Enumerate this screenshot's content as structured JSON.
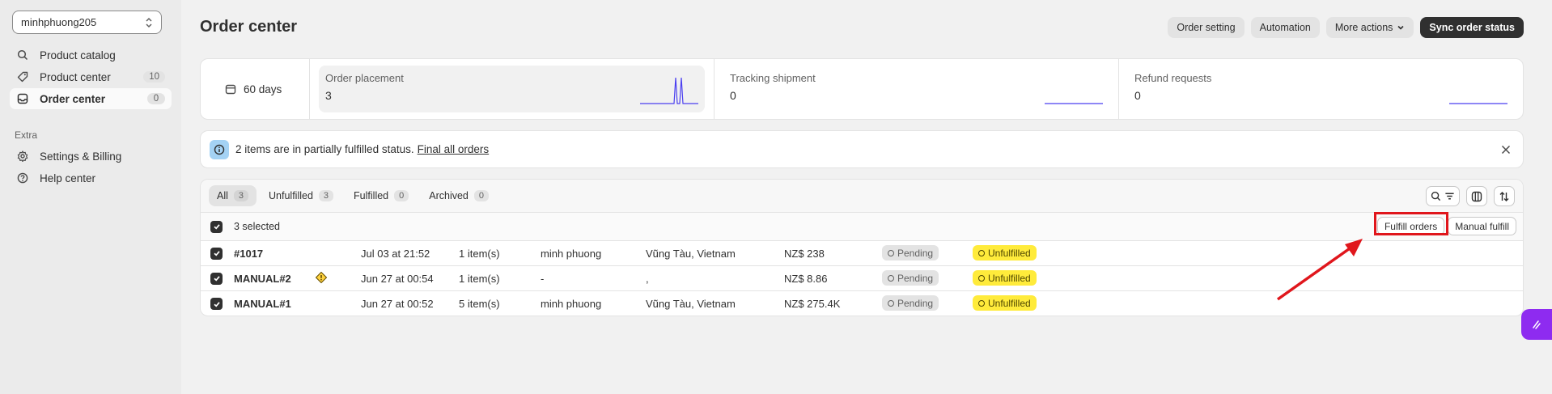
{
  "sidebar": {
    "store": "minhphuong205",
    "items": [
      {
        "label": "Product catalog",
        "count": ""
      },
      {
        "label": "Product center",
        "count": "10"
      },
      {
        "label": "Order center",
        "count": "0"
      }
    ],
    "extra_label": "Extra",
    "extra_items": [
      {
        "label": "Settings & Billing"
      },
      {
        "label": "Help center"
      }
    ]
  },
  "header": {
    "title": "Order center",
    "actions": {
      "order_setting": "Order setting",
      "automation": "Automation",
      "more_actions": "More actions",
      "sync": "Sync order status"
    }
  },
  "stats": {
    "range": "60 days",
    "cards": [
      {
        "label": "Order placement",
        "value": "3"
      },
      {
        "label": "Tracking shipment",
        "value": "0"
      },
      {
        "label": "Refund requests",
        "value": "0"
      }
    ]
  },
  "banner": {
    "text": "2 items are in partially fulfilled status.",
    "link": "Final all orders"
  },
  "tabs": [
    {
      "label": "All",
      "count": "3"
    },
    {
      "label": "Unfulfilled",
      "count": "3"
    },
    {
      "label": "Fulfilled",
      "count": "0"
    },
    {
      "label": "Archived",
      "count": "0"
    }
  ],
  "bulk": {
    "selected": "3 selected",
    "fulfill_orders": "Fulfill orders",
    "manual_fulfill": "Manual fulfill"
  },
  "orders": [
    {
      "id": "#1017",
      "date": "Jul 03 at 21:52",
      "items": "1 item(s)",
      "customer": "minh phuong",
      "location": "Vũng Tàu, Vietnam",
      "total": "NZ$ 238",
      "status": "Pending",
      "fulfillment": "Unfulfilled"
    },
    {
      "id": "MANUAL#2",
      "date": "Jun 27 at 00:54",
      "items": "1 item(s)",
      "customer": "-",
      "location": ",",
      "total": "NZ$ 8.86",
      "status": "Pending",
      "fulfillment": "Unfulfilled"
    },
    {
      "id": "MANUAL#1",
      "date": "Jun 27 at 00:52",
      "items": "5 item(s)",
      "customer": "minh phuong",
      "location": "Vũng Tàu, Vietnam",
      "total": "NZ$ 275.4K",
      "status": "Pending",
      "fulfillment": "Unfulfilled"
    }
  ],
  "colors": {
    "accent": "#303030",
    "highlight": "#e0161c",
    "unfulfilled_badge": "#ffeb3b",
    "sparkline": "#4b3ff0",
    "fab": "#8e2bf0"
  }
}
